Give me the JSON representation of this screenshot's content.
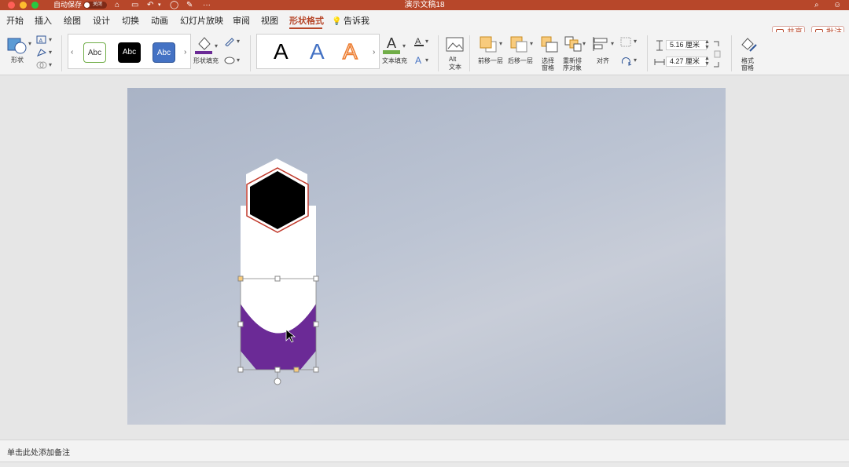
{
  "titlebar": {
    "autosave_label": "自动保存",
    "autosave_state": "关闭",
    "document_title": "演示文稿18",
    "more_label": "···",
    "color": "#b7472a"
  },
  "tabs": [
    {
      "label": "开始"
    },
    {
      "label": "插入"
    },
    {
      "label": "绘图"
    },
    {
      "label": "设计"
    },
    {
      "label": "切换"
    },
    {
      "label": "动画"
    },
    {
      "label": "幻灯片放映"
    },
    {
      "label": "审阅"
    },
    {
      "label": "视图"
    },
    {
      "label": "形状格式",
      "active": true
    },
    {
      "label": "告诉我"
    }
  ],
  "actions": {
    "share": "共享",
    "comments": "批注"
  },
  "ribbon": {
    "shapes_label": "形状",
    "style_samples": [
      "Abc",
      "Abc",
      "Abc"
    ],
    "shape_fill_label": "形状填充",
    "wordart_samples": [
      "A",
      "A",
      "A"
    ],
    "text_fill_label": "文本填充",
    "alt_text_line1": "Alt",
    "alt_text_line2": "文本",
    "bring_forward": "前移一层",
    "send_backward": "后移一层",
    "selection_pane_line1": "选择",
    "selection_pane_line2": "窗格",
    "reorder_line1": "重新排",
    "reorder_line2": "序对象",
    "align": "对齐",
    "height_value": "5.16 厘米",
    "width_value": "4.27 厘米",
    "format_pane_line1": "格式",
    "format_pane_line2": "窗格"
  },
  "notes": {
    "placeholder": "单击此处添加备注"
  },
  "slide": {
    "shape_colors": {
      "hexagon": "#000000",
      "hexagon_outline": "#c0392b",
      "panel": "#ffffff",
      "accent": "#6b2a96"
    }
  }
}
